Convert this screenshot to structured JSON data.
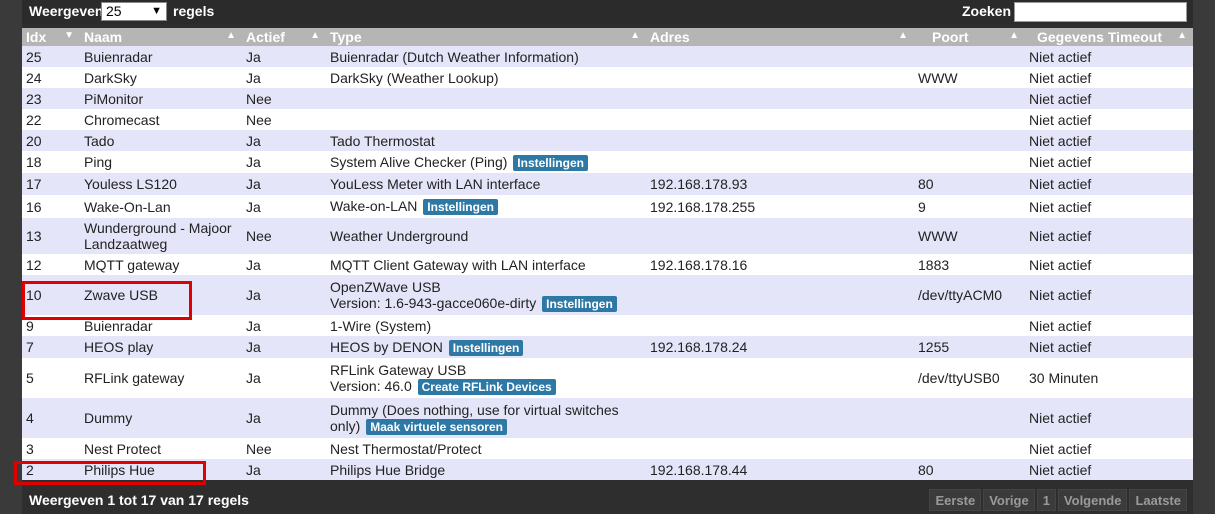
{
  "toolbar": {
    "show_label": "Weergeven",
    "page_size": "25",
    "rows_label": "regels",
    "search_label": "Zoeken :",
    "search_value": ""
  },
  "columns": [
    "Idx",
    "Naam",
    "Actief",
    "Type",
    "Adres",
    "Poort",
    "Gegevens Timeout"
  ],
  "rows": [
    {
      "idx": "25",
      "name": "Buienradar",
      "active": "Ja",
      "type": "Buienradar (Dutch Weather Information)",
      "btn": "",
      "addr": "",
      "port": "",
      "timeout": "Niet actief"
    },
    {
      "idx": "24",
      "name": "DarkSky",
      "active": "Ja",
      "type": "DarkSky (Weather Lookup)",
      "btn": "",
      "addr": "",
      "port": "WWW",
      "timeout": "Niet actief"
    },
    {
      "idx": "23",
      "name": "PiMonitor",
      "active": "Nee",
      "type": "",
      "btn": "",
      "addr": "",
      "port": "",
      "timeout": "Niet actief"
    },
    {
      "idx": "22",
      "name": "Chromecast",
      "active": "Nee",
      "type": "",
      "btn": "",
      "addr": "",
      "port": "",
      "timeout": "Niet actief"
    },
    {
      "idx": "20",
      "name": "Tado",
      "active": "Ja",
      "type": "Tado Thermostat",
      "btn": "",
      "addr": "",
      "port": "",
      "timeout": "Niet actief"
    },
    {
      "idx": "18",
      "name": "Ping",
      "active": "Ja",
      "type": "System Alive Checker (Ping)",
      "btn": "Instellingen",
      "addr": "",
      "port": "",
      "timeout": "Niet actief"
    },
    {
      "idx": "17",
      "name": "Youless LS120",
      "active": "Ja",
      "type": "YouLess Meter with LAN interface",
      "btn": "",
      "addr": "192.168.178.93",
      "port": "80",
      "timeout": "Niet actief"
    },
    {
      "idx": "16",
      "name": "Wake-On-Lan",
      "active": "Ja",
      "type": "Wake-on-LAN",
      "btn": "Instellingen",
      "addr": "192.168.178.255",
      "port": "9",
      "timeout": "Niet actief"
    },
    {
      "idx": "13",
      "name": "Wunderground - Majoor Landzaatweg",
      "active": "Nee",
      "type": "Weather Underground",
      "btn": "",
      "addr": "",
      "port": "WWW",
      "timeout": "Niet actief"
    },
    {
      "idx": "12",
      "name": "MQTT gateway",
      "active": "Ja",
      "type": "MQTT Client Gateway with LAN interface",
      "btn": "",
      "addr": "192.168.178.16",
      "port": "1883",
      "timeout": "Niet actief"
    },
    {
      "idx": "10",
      "name": "Zwave USB",
      "active": "Ja",
      "type": "OpenZWave USB",
      "type2": "Version: 1.6-943-gacce060e-dirty",
      "btn": "Instellingen",
      "addr": "",
      "port": "/dev/ttyACM0",
      "timeout": "Niet actief"
    },
    {
      "idx": "9",
      "name": "Buienradar",
      "active": "Ja",
      "type": "1-Wire (System)",
      "btn": "",
      "addr": "",
      "port": "",
      "timeout": "Niet actief"
    },
    {
      "idx": "7",
      "name": "HEOS play",
      "active": "Ja",
      "type": "HEOS by DENON",
      "btn": "Instellingen",
      "addr": "192.168.178.24",
      "port": "1255",
      "timeout": "Niet actief"
    },
    {
      "idx": "5",
      "name": "RFLink gateway",
      "active": "Ja",
      "type": "RFLink Gateway USB",
      "type2": "Version: 46.0",
      "btn": "Create RFLink Devices",
      "addr": "",
      "port": "/dev/ttyUSB0",
      "timeout": "30 Minuten"
    },
    {
      "idx": "4",
      "name": "Dummy",
      "active": "Ja",
      "type": "Dummy (Does nothing, use for virtual switches",
      "type2": "only)",
      "btn": "Maak virtuele sensoren",
      "addr": "",
      "port": "",
      "timeout": "Niet actief"
    },
    {
      "idx": "3",
      "name": "Nest Protect",
      "active": "Nee",
      "type": "Nest Thermostat/Protect",
      "btn": "",
      "addr": "",
      "port": "",
      "timeout": "Niet actief"
    },
    {
      "idx": "2",
      "name": "Philips Hue",
      "active": "Ja",
      "type": "Philips Hue Bridge",
      "btn": "",
      "addr": "192.168.178.44",
      "port": "80",
      "timeout": "Niet actief"
    }
  ],
  "footer": {
    "info": "Weergeven 1 tot 17 van 17 regels",
    "first": "Eerste",
    "prev": "Vorige",
    "page": "1",
    "next": "Volgende",
    "last": "Laatste"
  },
  "colors": {
    "header_bg": "#b5b5b5",
    "row_odd": "#e5e5fa",
    "button": "#2e78a6",
    "highlight": "#e00000"
  }
}
